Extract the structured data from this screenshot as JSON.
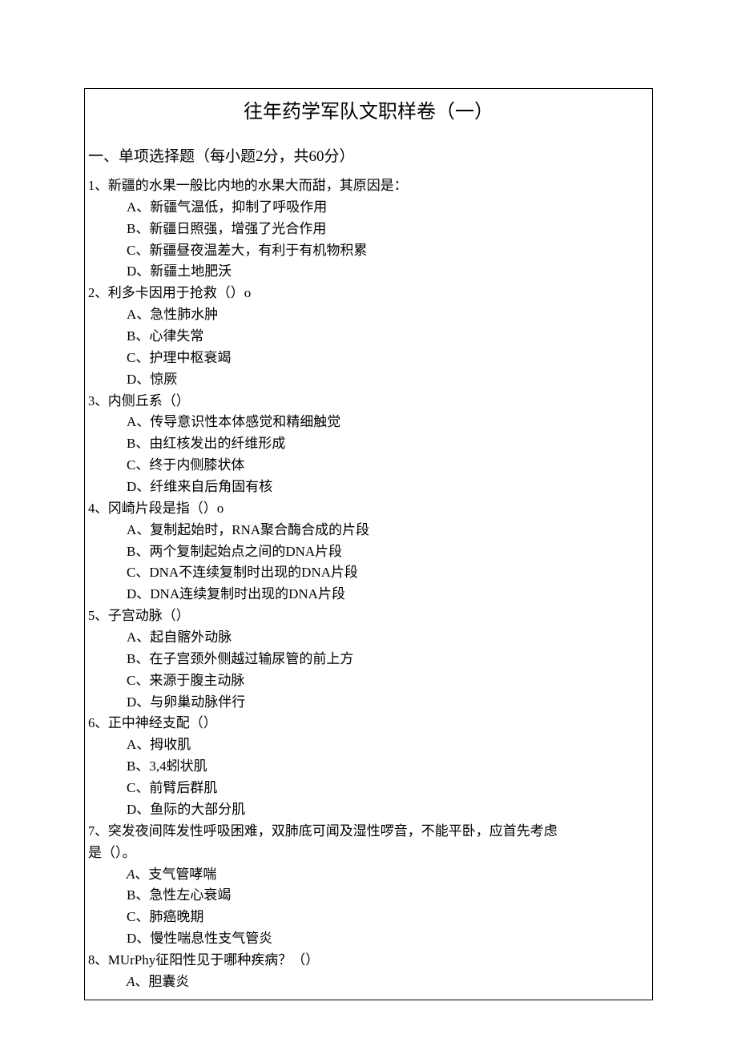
{
  "title": "往年药学军队文职样卷（一）",
  "section_header": "一、单项选择题（每小题2分，共60分）",
  "questions": [
    {
      "num": "1、",
      "text": "新疆的水果一般比内地的水果大而甜，其原因是：",
      "options": [
        "A、新疆气温低，抑制了呼吸作用",
        "B、新疆日照强，增强了光合作用",
        "C、新疆昼夜温差大，有利于有机物积累",
        "D、新疆土地肥沃"
      ]
    },
    {
      "num": "2、",
      "text": "利多卡因用于抢救（）o",
      "options": [
        "A、急性肺水肿",
        "B、心律失常",
        "C、护理中枢衰竭",
        "D、惊厥"
      ]
    },
    {
      "num": "3、",
      "text": "内侧丘系（）",
      "options": [
        "A、传导意识性本体感觉和精细触觉",
        "B、由红核发出的纤维形成",
        "C、终于内侧膝状体",
        "D、纤维来自后角固有核"
      ]
    },
    {
      "num": "4、",
      "text": "冈崎片段是指（）o",
      "options": [
        "A、复制起始时，RNA聚合酶合成的片段",
        "B、两个复制起始点之间的DNA片段",
        "C、DNA不连续复制时出现的DNA片段",
        "D、DNA连续复制时出现的DNA片段"
      ]
    },
    {
      "num": "5、",
      "text": "子宫动脉（）",
      "options": [
        "A、起自髂外动脉",
        "B、在子宫颈外侧越过输尿管的前上方",
        "C、来源于腹主动脉",
        "D、与卵巢动脉伴行"
      ]
    },
    {
      "num": "6、",
      "text": "正中神经支配（）",
      "options": [
        "A、拇收肌",
        "B、3,4蚓状肌",
        "C、前臂后群肌",
        "D、鱼际的大部分肌"
      ]
    },
    {
      "num": "7、",
      "text": "突发夜间阵发性呼吸困难，双肺底可闻及湿性啰音，不能平卧，应首先考虑",
      "text2": "是（）。",
      "options": [
        "A、支气管哮喘",
        "B、急性左心衰竭",
        "C、肺癌晚期",
        "D、慢性喘息性支气管炎"
      ],
      "first_italic": true
    },
    {
      "num": "8、",
      "text": "MUrPhy征阳性见于哪种疾病？（）",
      "options": [
        "A、胆囊炎"
      ],
      "first_italic": true
    }
  ]
}
